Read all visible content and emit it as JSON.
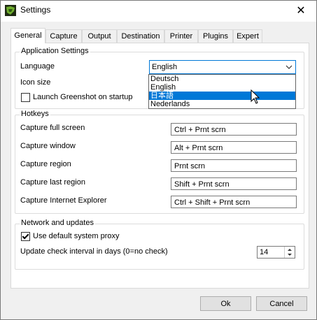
{
  "window": {
    "title": "Settings",
    "icon": "greenshot-app-icon",
    "close_glyph": "✕"
  },
  "tabs": [
    {
      "label": "General",
      "active": true
    },
    {
      "label": "Capture"
    },
    {
      "label": "Output"
    },
    {
      "label": "Destination"
    },
    {
      "label": "Printer"
    },
    {
      "label": "Plugins"
    },
    {
      "label": "Expert"
    }
  ],
  "app_settings": {
    "title": "Application Settings",
    "language_label": "Language",
    "language_value": "English",
    "language_options": [
      "Deutsch",
      "English",
      "日本語",
      "Nederlands"
    ],
    "language_highlighted": "日本語",
    "icon_size_label": "Icon size",
    "launch_label": "Launch Greenshot on startup",
    "launch_checked": false
  },
  "hotkeys": {
    "title": "Hotkeys",
    "items": [
      {
        "label": "Capture full screen",
        "value": "Ctrl + Prnt scrn"
      },
      {
        "label": "Capture window",
        "value": "Alt + Prnt scrn"
      },
      {
        "label": "Capture region",
        "value": "Prnt scrn"
      },
      {
        "label": "Capture last region",
        "value": "Shift + Prnt scrn"
      },
      {
        "label": "Capture Internet Explorer",
        "value": "Ctrl + Shift + Prnt scrn"
      }
    ]
  },
  "network": {
    "title": "Network and updates",
    "proxy_label": "Use default system proxy",
    "proxy_checked": true,
    "interval_label": "Update check interval in days (0=no check)",
    "interval_value": "14"
  },
  "buttons": {
    "ok": "Ok",
    "cancel": "Cancel"
  },
  "colors": {
    "accent": "#0078d7",
    "selection": "#0078d7",
    "panel": "#ffffff",
    "window": "#f0f0f0"
  }
}
